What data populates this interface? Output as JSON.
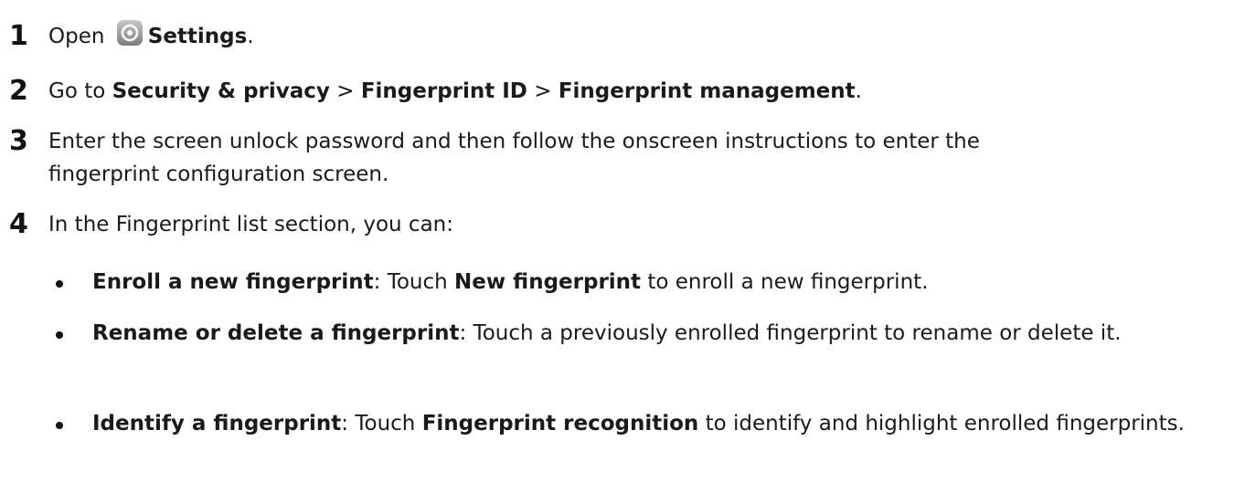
{
  "steps": [
    {
      "number": "1",
      "before": "Open ",
      "bold": "Settings",
      "after": ".",
      "icon": "settings-icon"
    },
    {
      "number": "2",
      "prefix": "Go to ",
      "b1": "Security & privacy",
      "sep1": " > ",
      "b2": "Fingerprint ID",
      "sep2": " > ",
      "b3": "Fingerprint management",
      "suffix": "."
    },
    {
      "number": "3",
      "line1": "Enter the screen unlock password and then follow the onscreen instructions to enter the",
      "line2": "fingerprint configuration screen."
    },
    {
      "number": "4",
      "text": "In the Fingerprint list section, you can:",
      "bullets": [
        {
          "title": "Enroll a new fingerprint",
          "pre": ": Touch ",
          "bold": "New fingerprint",
          "post": " to enroll a new fingerprint."
        },
        {
          "title": "Rename or delete a fingerprint",
          "post": ": Touch a previously enrolled fingerprint to rename or delete it."
        },
        {
          "title": "Identify a fingerprint",
          "pre": ": Touch ",
          "bold": "Fingerprint recognition",
          "post": " to identify and highlight enrolled fingerprints."
        }
      ]
    }
  ]
}
